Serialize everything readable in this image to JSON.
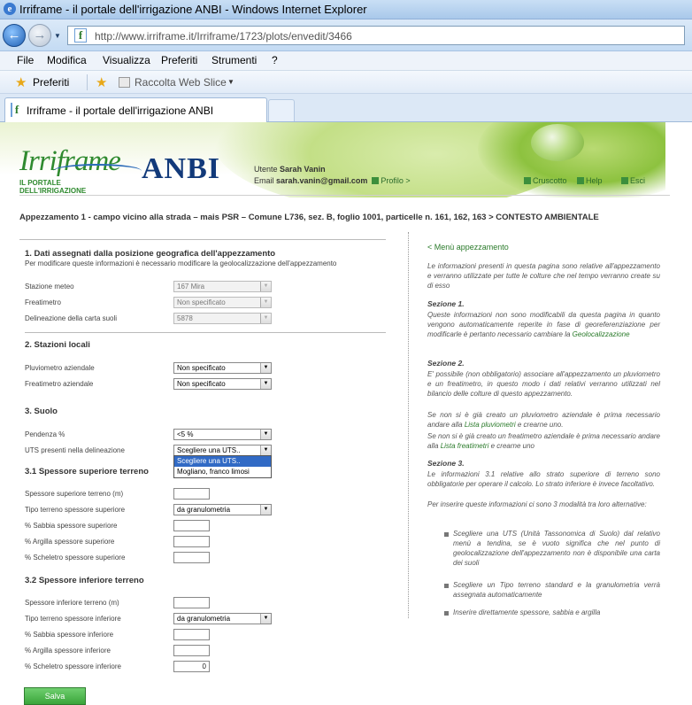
{
  "browser": {
    "title": "Irriframe - il portale dell'irrigazione ANBI - Windows Internet Explorer",
    "url": "http://www.irriframe.it/Irriframe/1723/plots/envedit/3466",
    "menu": [
      "File",
      "Modifica",
      "Visualizza",
      "Preferiti",
      "Strumenti",
      "?"
    ],
    "favorites_label": "Preferiti",
    "web_slice_label": "Raccolta Web Slice",
    "tab_label": "Irriframe - il portale dell'irrigazione ANBI"
  },
  "header": {
    "logo_text": "Irriframe",
    "logo_sub": "IL PORTALE DELL'IRRIGAZIONE",
    "anbi_text": "ANBI",
    "user_label": "Utente",
    "user_name": "Sarah Vanin",
    "email_label": "Email",
    "email_value": "sarah.vanin@gmail.com",
    "profile_link": "Profilo >",
    "links": {
      "dashboard": "Cruscotto",
      "help": "Help",
      "logout": "Esci"
    }
  },
  "breadcrumb": "Appezzamento 1 - campo vicino alla strada – mais PSR – Comune L736, sez. B, foglio 1001, particelle n. 161, 162, 163 > CONTESTO AMBIENTALE",
  "form": {
    "s1_title": "1. Dati assegnati dalla posizione geografica dell'appezzamento",
    "s1_note": "Per modificare queste informazioni è necessario modificare la geolocalizzazione dell'appezzamento",
    "s1_fields": [
      {
        "label": "Stazione meteo",
        "value": "167 Mira"
      },
      {
        "label": "Freatimetro",
        "value": "Non specificato"
      },
      {
        "label": "Delineazione della carta suoli",
        "value": "5878"
      }
    ],
    "s2_title": "2. Stazioni locali",
    "s2_fields": [
      {
        "label": "Pluviometro aziendale",
        "value": "Non specificato"
      },
      {
        "label": "Freatimetro aziendale",
        "value": "Non specificato"
      }
    ],
    "s3_title": "3. Suolo",
    "pendenza_label": "Pendenza %",
    "pendenza_value": "<5 %",
    "uts_label": "UTS presenti nella delineazione",
    "uts_value": "Scegliere una UTS..",
    "uts_options": [
      "Scegliere una UTS..",
      "Mogliano, franco limosi"
    ],
    "s31_title": "3.1 Spessore superiore terreno",
    "s31_fields": {
      "spessore": "Spessore superiore terreno (m)",
      "tipo": "Tipo terreno spessore superiore",
      "tipo_value": "da granulometria",
      "sabbia": "% Sabbia spessore superiore",
      "argilla": "% Argilla spessore superiore",
      "scheletro": "% Scheletro spessore superiore"
    },
    "s32_title": "3.2 Spessore inferiore terreno",
    "s32_fields": {
      "spessore": "Spessore inferiore terreno (m)",
      "tipo": "Tipo terreno spessore inferiore",
      "tipo_value": "da granulometria",
      "sabbia": "% Sabbia spessore inferiore",
      "argilla": "% Argilla spessore inferiore",
      "scheletro": "% Scheletro spessore inferiore",
      "scheletro_value": "0"
    },
    "save_label": "Salva"
  },
  "help": {
    "menu_link": "< Menù appezzamento",
    "intro": "Le informazioni presenti in questa pagina sono relative all'appezzamento e verranno utilizzate per tutte le colture che nel tempo verranno create su di esso",
    "sez1_title": "Sezione 1.",
    "sez1_text": "Queste informazioni non sono modificabili da questa pagina in quanto vengono automaticamente reperite in fase di georeferenziazione per modificarle è pertanto necessario cambiare la",
    "sez1_link": "Geolocalizzazione",
    "sez2_title": "Sezione 2.",
    "sez2_text": "E' possibile (non obbligatorio) associare all'appezzamento un pluviometro e un freatimetro, in questo modo i dati relativi verranno utilizzati nel bilancio delle colture di questo appezzamento.",
    "sez2_text2_a": "Se non si è già creato un pluviometro aziendale è prima necessario andare alla",
    "sez2_link2": "Lista pluviometri",
    "sez2_text2_b": "e crearne uno.",
    "sez2_text3_a": "Se non si è già creato un freatimetro aziendale è prima necessario andare alla",
    "sez2_link3": "Lista freatimetri",
    "sez2_text3_b": "e crearne uno",
    "sez3_title": "Sezione 3.",
    "sez3_text": "Le informazioni 3.1 relative allo strato superiore di terreno sono obbligatorie per operare il calcolo. Lo strato inferiore è invece facoltativo.",
    "sez3_text2": "Per inserire queste informazioni ci sono 3 modalità tra loro alternative:",
    "bullets": [
      "Scegliere una UTS (Unità Tassonomica di Suolo) dal relativo menù a tendina, se è vuoto significa che nel punto di geolocalizzazione dell'appezzamento non è disponibile una carta dei suoli",
      "Scegliere un Tipo terreno standard e la granulometria verrà assegnata automaticamente",
      "Inserire direttamente spessore, sabbia e argilla"
    ]
  }
}
